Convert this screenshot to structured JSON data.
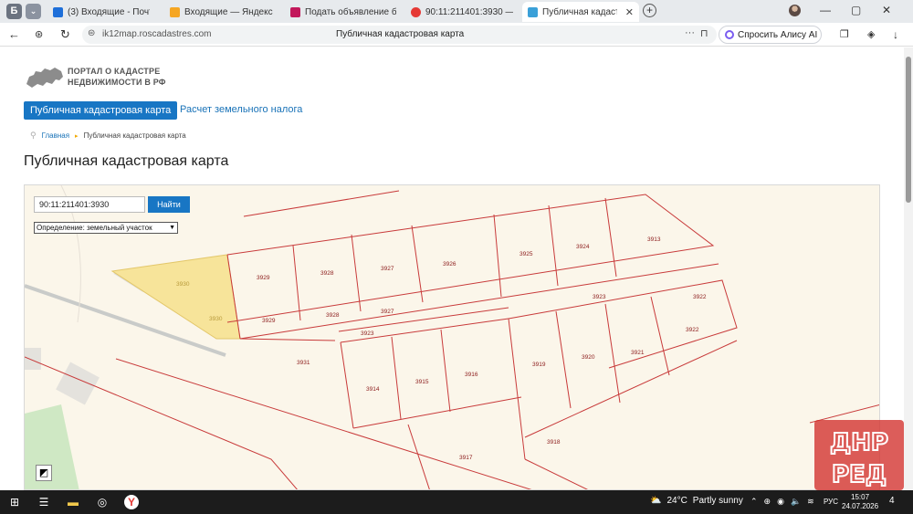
{
  "browser": {
    "tabs": [
      {
        "title": "(3) Входящие - Почта Ма",
        "color": "#1e6fd9"
      },
      {
        "title": "Входящие — Яндекс Почт",
        "color": "#f5a623"
      },
      {
        "title": "Подать объявление бесп",
        "color": "#c2185b"
      },
      {
        "title": "90:11:211401:3930 — Янд",
        "color": "#e53935"
      },
      {
        "title": "Публичная кадастровая",
        "color": "#3aa0d8",
        "active": true
      }
    ],
    "address": {
      "host": "ik12map.roscadastres.com",
      "page_title": "Публичная кадастровая карта",
      "alice_label": "Спросить Алису AI"
    },
    "accent": "#1876c4"
  },
  "site": {
    "portal_title_line1": "ПОРТАЛ О КАДАСТРЕ",
    "portal_title_line2": "НЕДВИЖИМОСТИ В РФ",
    "menu_active": "Публичная кадастровая карта",
    "menu_link": "Расчет земельного налога",
    "breadcrumb_home": "Главная",
    "breadcrumb_current": "Публичная кадастровая карта",
    "heading": "Публичная кадастровая карта"
  },
  "map": {
    "search_value": "90:11:211401:3930",
    "search_button": "Найти",
    "select_value": "Определение:  земельный участок",
    "parcels": [
      {
        "label": "3930",
        "highlight": true
      },
      {
        "label": "3930",
        "highlight": true
      },
      {
        "label": "3929"
      },
      {
        "label": "3929"
      },
      {
        "label": "3928"
      },
      {
        "label": "3928"
      },
      {
        "label": "3927"
      },
      {
        "label": "3927"
      },
      {
        "label": "3926"
      },
      {
        "label": "3925"
      },
      {
        "label": "3924"
      },
      {
        "label": "3913"
      },
      {
        "label": "3923"
      },
      {
        "label": "3922"
      },
      {
        "label": "3922"
      },
      {
        "label": "3923"
      },
      {
        "label": "3931"
      },
      {
        "label": "3914"
      },
      {
        "label": "3915"
      },
      {
        "label": "3916"
      },
      {
        "label": "3919"
      },
      {
        "label": "3920"
      },
      {
        "label": "3921"
      },
      {
        "label": "3918"
      },
      {
        "label": "3917"
      }
    ],
    "watermark": "ДНР РЕД"
  },
  "taskbar": {
    "weather_temp": "24°C",
    "weather_text": "Partly sunny",
    "lang": "РУС",
    "time": "15:07",
    "date": "24.07.2026",
    "notifications": "4"
  }
}
